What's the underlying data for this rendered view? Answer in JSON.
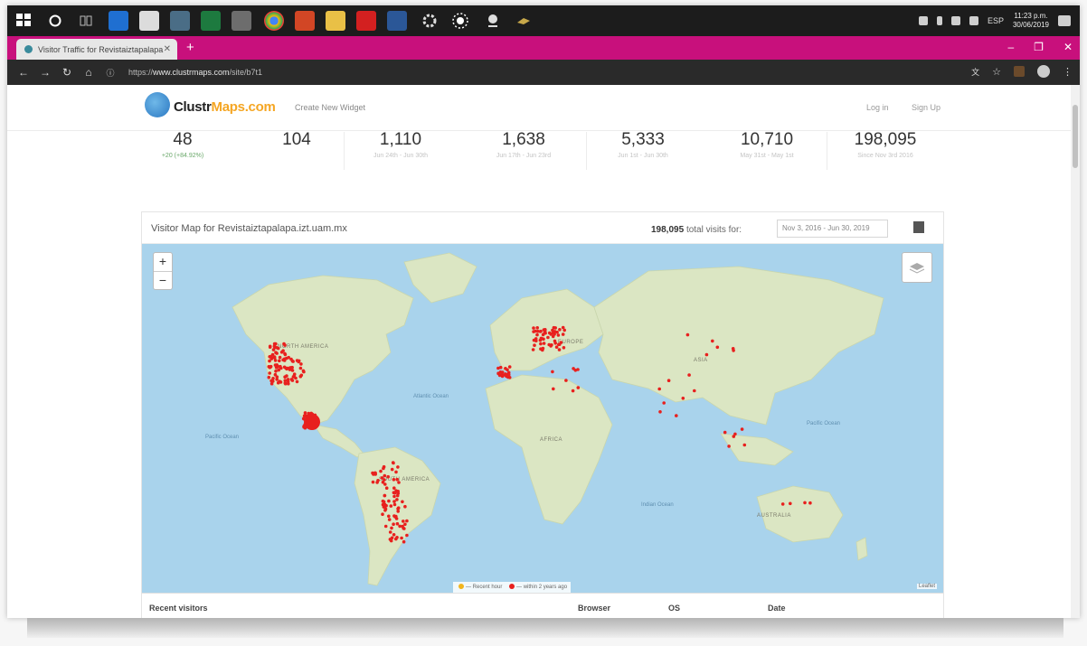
{
  "browser": {
    "tab_title": "Visitor Traffic for Revistaiztapalapa...",
    "url_prefix": "https://",
    "url_domain": "www.clustrmaps.com",
    "url_path": "/site/b7t1"
  },
  "taskbar": {
    "clock_time": "11:23 p.m.",
    "clock_date": "30/06/2019",
    "language": "ESP"
  },
  "site": {
    "logo_main": "Clustr",
    "logo_accent": "Maps.com",
    "create_widget": "Create New Widget",
    "login": "Log in",
    "signup": "Sign Up"
  },
  "stats": [
    {
      "value": "48",
      "caption": "+20 (+84.92%)",
      "caption_color": "#6aa86a"
    },
    {
      "value": "104",
      "caption": ""
    },
    {
      "value": "1,110",
      "caption": "Jun 24th - Jun 30th"
    },
    {
      "value": "1,638",
      "caption": "Jun 17th - Jun 23rd"
    },
    {
      "value": "5,333",
      "caption": "Jun 1st - Jun 30th"
    },
    {
      "value": "10,710",
      "caption": "May 31st - May 1st"
    },
    {
      "value": "198,095",
      "caption": "Since Nov 3rd 2016"
    }
  ],
  "map_panel": {
    "title": "Visitor Map for Revistaiztapalapa.izt.uam.mx",
    "total_number": "198,095",
    "total_label": "total visits for:",
    "date_range": "Nov 3, 2016 - Jun 30, 2019",
    "zoom_in": "+",
    "zoom_out": "−",
    "labels": {
      "north_america": "NORTH AMERICA",
      "south_america": "SOUTH AMERICA",
      "africa": "AFRICA",
      "asia": "ASIA",
      "australia": "AUSTRALIA",
      "atlantic": "Atlantic Ocean",
      "pacific_left": "Pacific Ocean",
      "pacific_right": "Pacific Ocean",
      "indian": "Indian Ocean",
      "europe": "EUROPE"
    },
    "legend_recent": "— Recent hour",
    "legend_older": "— within 2 years ago",
    "attribution": "Leaflet",
    "colors": {
      "ocean": "#a9d3ec",
      "land": "#dbe6c3",
      "marker": "#e8201e",
      "recent_marker": "#f2b51d"
    }
  },
  "recent_visitors": {
    "title": "Recent visitors",
    "browser": "Browser",
    "os": "OS",
    "date": "Date"
  }
}
